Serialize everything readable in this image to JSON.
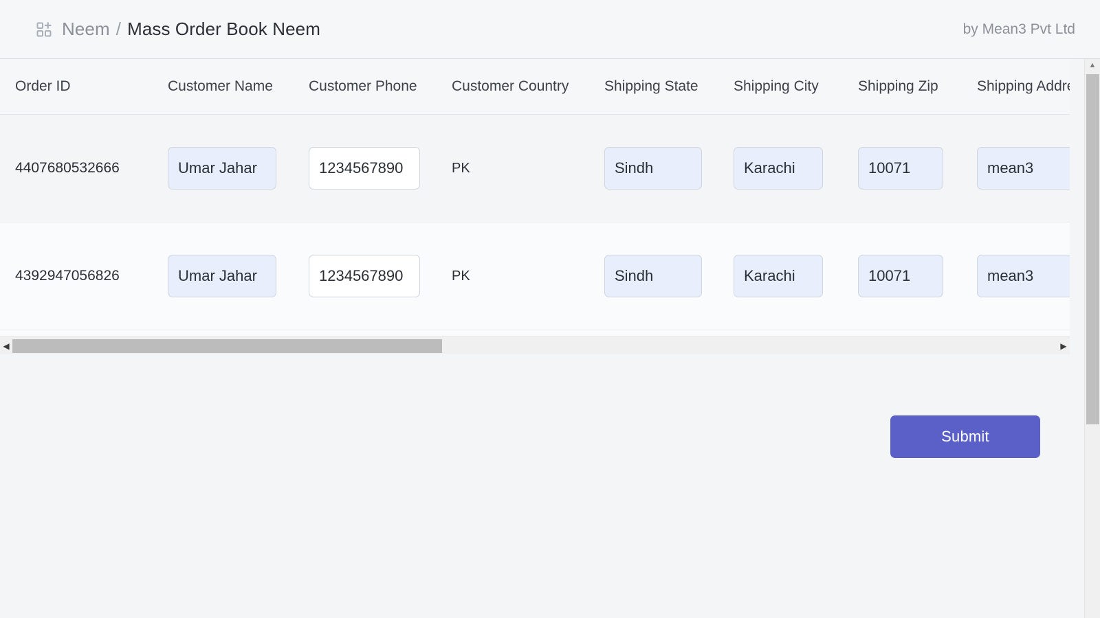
{
  "header": {
    "app_icon": "grid-plus-icon",
    "breadcrumb_root": "Neem",
    "breadcrumb_separator": "/",
    "breadcrumb_current": "Mass Order Book Neem",
    "attribution": "by Mean3 Pvt Ltd"
  },
  "table": {
    "columns": [
      "Order ID",
      "Customer Name",
      "Customer Phone",
      "Customer Country",
      "Shipping State",
      "Shipping City",
      "Shipping Zip",
      "Shipping Addre"
    ],
    "rows": [
      {
        "order_id": "4407680532666",
        "customer_name": "Umar Jahar",
        "customer_phone": "1234567890",
        "customer_country": "PK",
        "shipping_state": "Sindh",
        "shipping_city": "Karachi",
        "shipping_zip": "10071",
        "shipping_address": "mean3"
      },
      {
        "order_id": "4392947056826",
        "customer_name": "Umar Jahar",
        "customer_phone": "1234567890",
        "customer_country": "PK",
        "shipping_state": "Sindh",
        "shipping_city": "Karachi",
        "shipping_zip": "10071",
        "shipping_address": "mean3"
      }
    ]
  },
  "scrollbars": {
    "horizontal_left_arrow": "◀",
    "horizontal_right_arrow": "▶",
    "vertical_up_arrow": "▲"
  },
  "actions": {
    "submit_label": "Submit"
  },
  "colors": {
    "accent": "#5a60c8",
    "field_fill": "#e8eefc",
    "field_fill_active": "#ffffff",
    "field_border": "#cfd4dd",
    "page_bg": "#f4f5f7",
    "header_bg": "#f6f7f9",
    "row_a_bg": "#f4f5f7",
    "row_b_bg": "#fafbfc",
    "text_primary": "#2b2f36",
    "text_muted": "#8b9099"
  }
}
